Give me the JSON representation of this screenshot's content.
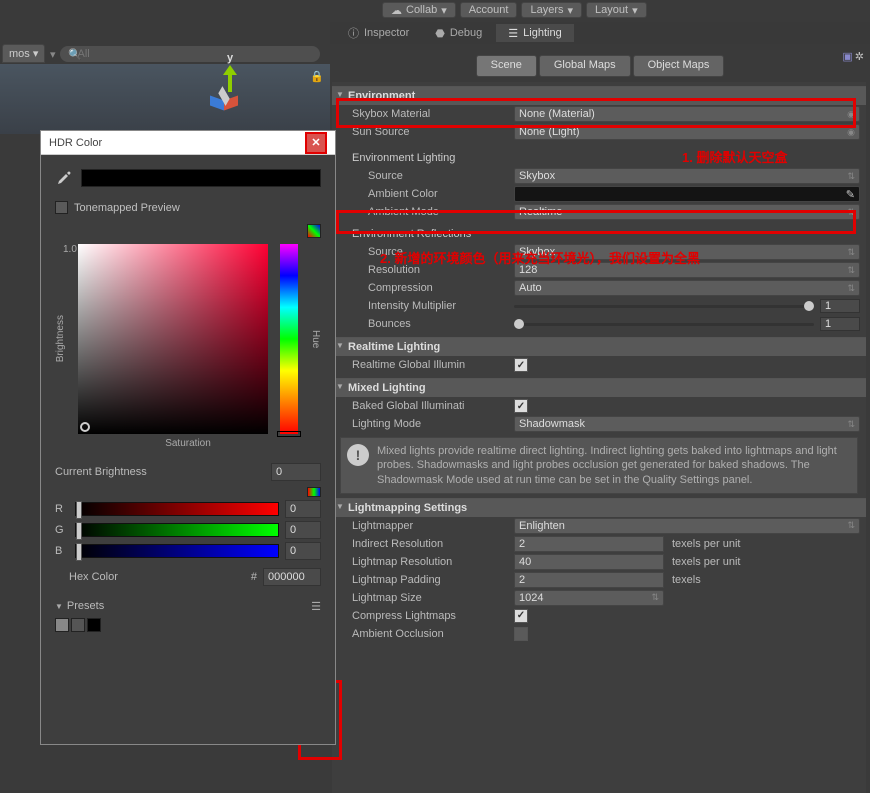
{
  "top_buttons": [
    "Collab",
    "Account",
    "Layers",
    "Layout"
  ],
  "tabs": {
    "inspector": "Inspector",
    "debug": "Debug",
    "lighting": "Lighting"
  },
  "sub_tabs": {
    "scene": "Scene",
    "global": "Global Maps",
    "object": "Object Maps"
  },
  "search_placeholder": "All",
  "gizmo": {
    "y": "y"
  },
  "left_tab": "mos",
  "sections": {
    "environment": {
      "title": "Environment",
      "skybox_label": "Skybox Material",
      "skybox_value": "None (Material)",
      "sun_label": "Sun Source",
      "sun_value": "None (Light)",
      "env_lighting": "Environment Lighting",
      "source_label": "Source",
      "source_value": "Skybox",
      "ambient_color_label": "Ambient Color",
      "ambient_mode_label": "Ambient Mode",
      "ambient_mode_value": "Realtime",
      "env_refl": "Environment Reflections",
      "refl_source_label": "Source",
      "refl_source_value": "Skybox",
      "resolution_label": "Resolution",
      "resolution_value": "128",
      "compression_label": "Compression",
      "compression_value": "Auto",
      "intensity_label": "Intensity Multiplier",
      "intensity_value": "1",
      "bounces_label": "Bounces",
      "bounces_value": "1"
    },
    "realtime": {
      "title": "Realtime Lighting",
      "rgi_label": "Realtime Global Illumin"
    },
    "mixed": {
      "title": "Mixed Lighting",
      "bgi_label": "Baked Global Illuminati",
      "mode_label": "Lighting Mode",
      "mode_value": "Shadowmask",
      "help": "Mixed lights provide realtime direct lighting. Indirect lighting gets baked into lightmaps and light probes. Shadowmasks and light probes occlusion get generated for baked shadows. The Shadowmask Mode used at run time can be set in the Quality Settings panel."
    },
    "lightmap": {
      "title": "Lightmapping Settings",
      "mapper_label": "Lightmapper",
      "mapper_value": "Enlighten",
      "indres_label": "Indirect Resolution",
      "indres_value": "2",
      "indres_unit": "texels per unit",
      "lmres_label": "Lightmap Resolution",
      "lmres_value": "40",
      "lmres_unit": "texels per unit",
      "pad_label": "Lightmap Padding",
      "pad_value": "2",
      "pad_unit": "texels",
      "size_label": "Lightmap Size",
      "size_value": "1024",
      "compress_label": "Compress Lightmaps",
      "ao_label": "Ambient Occlusion"
    }
  },
  "annotations": {
    "a1": "1. 删除默认天空盒",
    "a2": "2. 新增的环境颜色（用来充当环境光），我们设置为全黑"
  },
  "color_picker": {
    "title": "HDR Color",
    "tonemap": "Tonemapped Preview",
    "brightness": "Brightness",
    "saturation": "Saturation",
    "hue": "Hue",
    "one": "1.0",
    "cb_label": "Current Brightness",
    "cb_value": "0",
    "r": "R",
    "g": "G",
    "b": "B",
    "r_val": "0",
    "g_val": "0",
    "b_val": "0",
    "hex_label": "Hex Color",
    "hex_value": "000000",
    "presets": "Presets",
    "swatches": [
      "#888",
      "#555",
      "#000"
    ]
  }
}
